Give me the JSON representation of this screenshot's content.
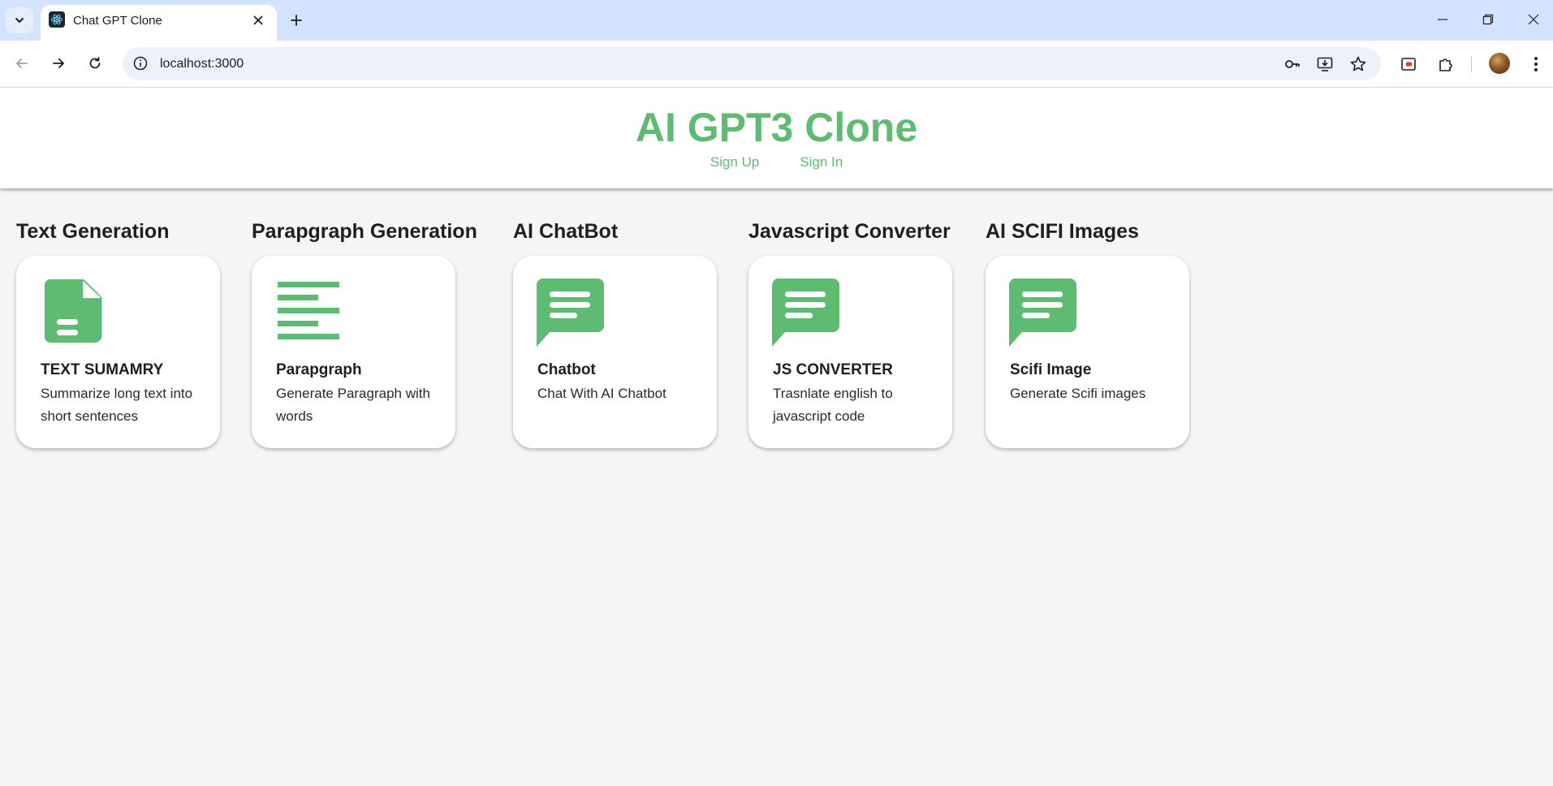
{
  "browser": {
    "tab_title": "Chat GPT Clone",
    "url": "localhost:3000"
  },
  "colors": {
    "accent": "#5fbb72",
    "background": "#f5f5f5",
    "tabstrip": "#d3e3fd"
  },
  "header": {
    "title": "AI GPT3 Clone",
    "sign_up": "Sign Up",
    "sign_in": "Sign In"
  },
  "sections": [
    {
      "heading": "Text Generation",
      "icon": "document-icon",
      "name": "TEXT SUMAMRY",
      "description": "Summarize long text into short sentences"
    },
    {
      "heading": "Parapgraph Generation",
      "icon": "align-left-icon",
      "name": "Parapgraph",
      "description": "Generate Paragraph with words"
    },
    {
      "heading": "AI ChatBot",
      "icon": "chat-bubble-icon",
      "name": "Chatbot",
      "description": "Chat With AI Chatbot"
    },
    {
      "heading": "Javascript Converter",
      "icon": "chat-bubble-icon",
      "name": "JS CONVERTER",
      "description": "Trasnlate english to javascript code"
    },
    {
      "heading": "AI SCIFI Images",
      "icon": "chat-bubble-icon",
      "name": "Scifi Image",
      "description": "Generate Scifi images"
    }
  ]
}
